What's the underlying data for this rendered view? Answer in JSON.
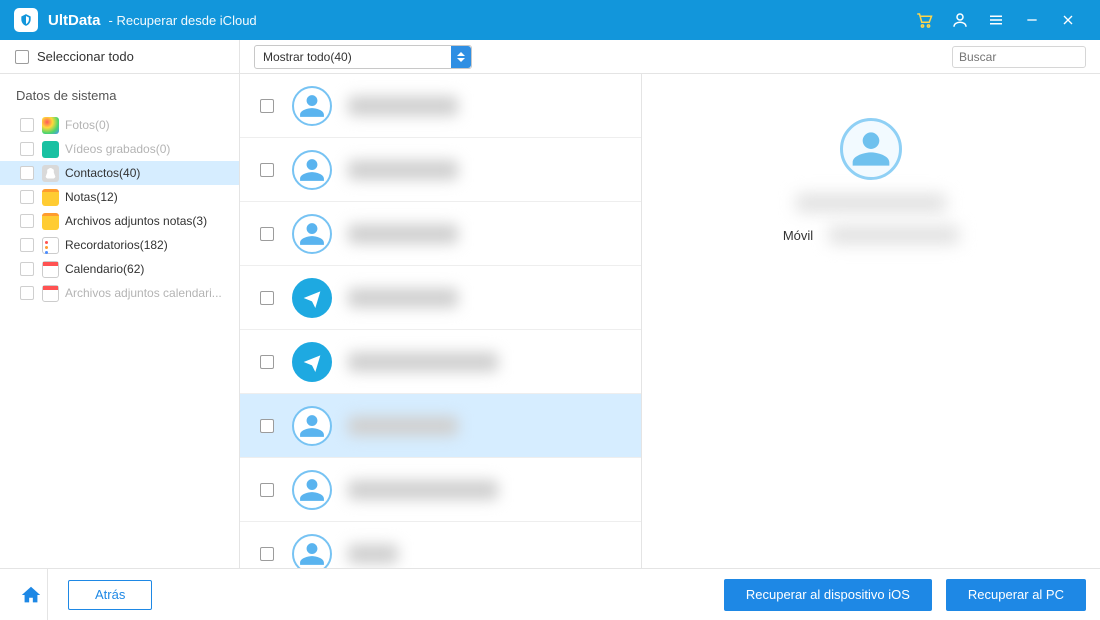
{
  "titlebar": {
    "app_name": "UltData",
    "subtitle": "-   Recuperar desde iCloud"
  },
  "toolbar": {
    "select_all_label": "Seleccionar todo",
    "filter_label": "Mostrar todo(40)",
    "search_placeholder": "Buscar"
  },
  "sidebar": {
    "group_title": "Datos de sistema",
    "items": [
      {
        "label": "Fotos(0)",
        "muted": true,
        "icon": "photos"
      },
      {
        "label": "Vídeos grabados(0)",
        "muted": true,
        "icon": "videos"
      },
      {
        "label": "Contactos(40)",
        "muted": false,
        "icon": "contacts",
        "selected": true
      },
      {
        "label": "Notas(12)",
        "muted": false,
        "icon": "notes"
      },
      {
        "label": "Archivos adjuntos notas(3)",
        "muted": false,
        "icon": "notes2"
      },
      {
        "label": "Recordatorios(182)",
        "muted": false,
        "icon": "reminders"
      },
      {
        "label": "Calendario(62)",
        "muted": false,
        "icon": "calendar"
      },
      {
        "label": "Archivos adjuntos calendari...",
        "muted": true,
        "icon": "calatt"
      }
    ]
  },
  "contacts": [
    {
      "style": "outline",
      "selected": false,
      "width": "normal"
    },
    {
      "style": "outline",
      "selected": false,
      "width": "normal"
    },
    {
      "style": "outline",
      "selected": false,
      "width": "normal"
    },
    {
      "style": "solid",
      "selected": false,
      "width": "normal"
    },
    {
      "style": "solid",
      "selected": false,
      "width": "wide"
    },
    {
      "style": "outline",
      "selected": true,
      "width": "normal"
    },
    {
      "style": "outline",
      "selected": false,
      "width": "wide"
    },
    {
      "style": "outline",
      "selected": false,
      "width": "narrow"
    }
  ],
  "detail": {
    "field_label": "Móvil"
  },
  "footer": {
    "back_label": "Atrás",
    "recover_device_label": "Recuperar al dispositivo iOS",
    "recover_pc_label": "Recuperar al PC"
  }
}
